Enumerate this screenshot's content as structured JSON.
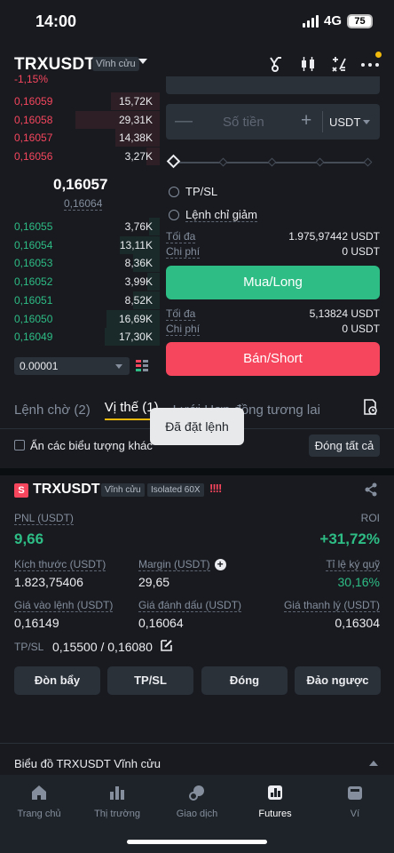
{
  "status_bar": {
    "time": "14:00",
    "network": "4G",
    "battery": "75"
  },
  "header": {
    "symbol": "TRXUSDT",
    "contract_type": "Vĩnh cửu",
    "change": "-1,15%",
    "icons": [
      "trophy-icon",
      "candlestick-chart-icon",
      "calculator-icon",
      "more-icon"
    ]
  },
  "order_book": {
    "asks": [
      {
        "price": "0,16059",
        "qty": "15,72K",
        "depth": 0.55
      },
      {
        "price": "0,16058",
        "qty": "29,31K",
        "depth": 0.95
      },
      {
        "price": "0,16057",
        "qty": "14,38K",
        "depth": 0.5
      },
      {
        "price": "0,16056",
        "qty": "3,27K",
        "depth": 0.15
      }
    ],
    "last_price": "0,16057",
    "mark_price": "0,16064",
    "bids": [
      {
        "price": "0,16055",
        "qty": "3,76K",
        "depth": 0.12
      },
      {
        "price": "0,16054",
        "qty": "13,11K",
        "depth": 0.45
      },
      {
        "price": "0,16053",
        "qty": "8,36K",
        "depth": 0.3
      },
      {
        "price": "0,16052",
        "qty": "3,99K",
        "depth": 0.14
      },
      {
        "price": "0,16051",
        "qty": "8,52K",
        "depth": 0.3
      },
      {
        "price": "0,16050",
        "qty": "16,69K",
        "depth": 0.6
      },
      {
        "price": "0,16049",
        "qty": "17,30K",
        "depth": 0.62
      }
    ],
    "step": "0.00001"
  },
  "order_form": {
    "amount_placeholder": "Số tiền",
    "amount_unit": "USDT",
    "options": [
      "TP/SL",
      "Lệnh chỉ giảm"
    ],
    "long": {
      "max_label": "Tối đa",
      "max_value": "1.975,97442 USDT",
      "cost_label": "Chi phí",
      "cost_value": "0 USDT",
      "button": "Mua/Long"
    },
    "short": {
      "max_label": "Tối đa",
      "max_value": "5,13824 USDT",
      "cost_label": "Chi phí",
      "cost_value": "0 USDT",
      "button": "Bán/Short"
    }
  },
  "tabs": {
    "pending": "Lệnh chờ (2)",
    "positions": "Vị thế (1)",
    "grid": "Lưới Hợp đồng tương lai"
  },
  "toast": "Đã đặt lệnh",
  "filter": {
    "hide_label": "Ẩn các biểu tượng khác",
    "close_all": "Đóng tất cả"
  },
  "position": {
    "side_badge": "S",
    "symbol": "TRXUSDT",
    "contract_type": "Vĩnh cửu",
    "margin_mode": "Isolated 60X",
    "warning": "!!!!",
    "pnl_label": "PNL (USDT)",
    "pnl_value": "9,66",
    "roi_label": "ROI",
    "roi_value": "+31,72%",
    "size_label": "Kích thước (USDT)",
    "size_value": "1.823,75406",
    "margin_label": "Margin (USDT)",
    "margin_value": "29,65",
    "ratio_label": "Tỉ lệ ký quỹ",
    "ratio_value": "30,16%",
    "entry_label": "Giá vào lệnh (USDT)",
    "entry_value": "0,16149",
    "mark_label": "Giá đánh dấu (USDT)",
    "mark_value": "0,16064",
    "liq_label": "Giá thanh lý (USDT)",
    "liq_value": "0,16304",
    "tpsl_label": "TP/SL",
    "tpsl_value": "0,15500 / 0,16080",
    "buttons": [
      "Đòn bẩy",
      "TP/SL",
      "Đóng",
      "Đảo ngược"
    ]
  },
  "chart_link": "Biểu đồ TRXUSDT Vĩnh cửu",
  "nav": [
    {
      "label": "Trang chủ",
      "icon": "home-icon"
    },
    {
      "label": "Thị trường",
      "icon": "market-icon"
    },
    {
      "label": "Giao dịch",
      "icon": "trade-icon"
    },
    {
      "label": "Futures",
      "icon": "futures-icon",
      "active": true
    },
    {
      "label": "Ví",
      "icon": "wallet-icon"
    }
  ],
  "colors": {
    "green": "#2ebd85",
    "red": "#f6465d",
    "bg": "#181a20",
    "accent": "#f0b90b"
  }
}
